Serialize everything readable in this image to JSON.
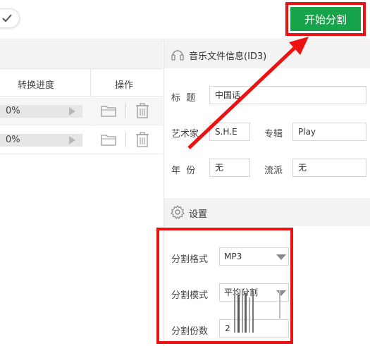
{
  "toolbar": {
    "start_button_label": "开始分割"
  },
  "file_list": {
    "col_progress": "转换进度",
    "col_actions": "操作",
    "rows": [
      {
        "progress": "0%"
      },
      {
        "progress": "0%"
      }
    ]
  },
  "id3": {
    "section_title": "音乐文件信息(ID3)",
    "title_label": "标  题",
    "title_value": "中国话",
    "artist_label": "艺术家",
    "artist_value": "S.H.E",
    "album_label": "专辑",
    "album_value": "Play",
    "year_label": "年  份",
    "year_value": "无",
    "genre_label": "流派",
    "genre_value": "无"
  },
  "settings": {
    "section_title": "设置",
    "format_label": "分割格式",
    "format_value": "MP3",
    "mode_label": "分割模式",
    "mode_value": "平均分割",
    "count_label": "分割份数",
    "count_value": "2"
  },
  "colors": {
    "accent_green": "#17a34a",
    "annotation_red": "#ee1111"
  },
  "icons": [
    "check-icon",
    "play-icon",
    "folder-icon",
    "trash-icon",
    "music-icon",
    "gear-icon",
    "dropdown-arrow-icon"
  ]
}
